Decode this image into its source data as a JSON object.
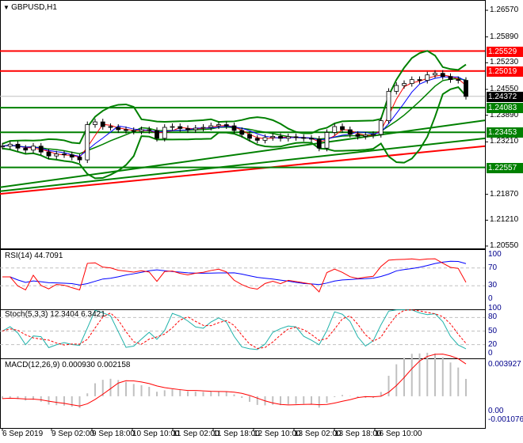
{
  "header": {
    "symbol": "GBPUSD,H1"
  },
  "price_axis": [
    "1.26570",
    "1.25890",
    "1.25230",
    "1.24550",
    "1.23890",
    "1.23210",
    "1.21870",
    "1.21210",
    "1.20550"
  ],
  "levels": [
    {
      "label": "1.25529",
      "value": 1.25529,
      "color": "#ff0000"
    },
    {
      "label": "1.25019",
      "value": 1.25019,
      "color": "#ff0000"
    },
    {
      "label": "1.24083",
      "value": 1.24083,
      "color": "#008000"
    },
    {
      "label": "1.23453",
      "value": 1.23453,
      "color": "#008000"
    },
    {
      "label": "1.22557",
      "value": 1.22557,
      "color": "#008000"
    }
  ],
  "current_price": {
    "label": "1.24372",
    "value": 1.24372
  },
  "rsi": {
    "title": "RSI(14) 44.7091",
    "axis": [
      "100",
      "70",
      "30",
      "0"
    ]
  },
  "stoch": {
    "title": "Stoch(5,3,3) 12.3404 6.3421",
    "axis": [
      "100",
      "80",
      "50",
      "20",
      "0"
    ]
  },
  "macd": {
    "title": "MACD(12,26,9) 0.000930 0.002158",
    "axis": [
      "0.003927",
      "0.00",
      "-0.001076"
    ]
  },
  "time_axis": [
    "6 Sep 2019",
    "9 Sep 02:00",
    "9 Sep 18:00",
    "10 Sep 10:00",
    "11 Sep 02:00",
    "11 Sep 18:00",
    "12 Sep 10:00",
    "13 Sep 02:00",
    "13 Sep 18:00",
    "16 Sep 10:00"
  ],
  "chart_data": {
    "type": "candlestick",
    "close": [
      1.231,
      1.2315,
      1.2305,
      1.23,
      1.231,
      1.2295,
      1.2285,
      1.229,
      1.2288,
      1.2282,
      1.2275,
      1.2365,
      1.2372,
      1.236,
      1.2358,
      1.2352,
      1.235,
      1.2348,
      1.2352,
      1.235,
      1.233,
      1.2358,
      1.236,
      1.2355,
      1.2352,
      1.2356,
      1.2358,
      1.2362,
      1.2365,
      1.2362,
      1.235,
      1.234,
      1.233,
      1.2325,
      1.2332,
      1.2335,
      1.233,
      1.2334,
      1.2332,
      1.233,
      1.2328,
      1.2305,
      1.2345,
      1.236,
      1.2352,
      1.234,
      1.2335,
      1.2338,
      1.234,
      1.2375,
      1.245,
      1.2465,
      1.247,
      1.248,
      1.2478,
      1.2492,
      1.2496,
      1.2488,
      1.248,
      1.2478,
      1.2437
    ],
    "trend_lines": [
      {
        "from": 1.2205,
        "to": 1.2376,
        "color": "#008000"
      },
      {
        "from": 1.2195,
        "to": 1.233,
        "color": "#008000"
      },
      {
        "from": 1.2188,
        "to": 1.231,
        "color": "#ff0000"
      }
    ],
    "ylim": [
      1.2055,
      1.2657
    ],
    "colors": {
      "bands": "#008000",
      "rsi": "#ff0000",
      "rsi_ma": "#0000ff",
      "stoch_main": "#20b2aa",
      "stoch_signal": "#ff0000",
      "macd_hist": "#c0c0c0",
      "macd_signal": "#ff0000"
    }
  }
}
